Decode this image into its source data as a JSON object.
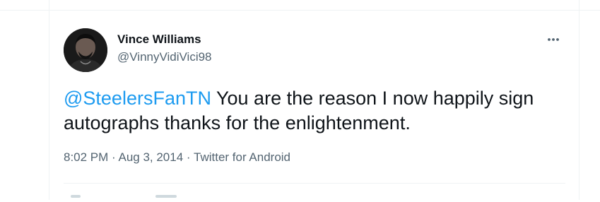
{
  "tweet": {
    "author": {
      "display_name": "Vince Williams",
      "handle": "@VinnyVidiVici98"
    },
    "text": {
      "mention": "@SteelersFanTN",
      "body": " You are the reason I now happily sign autographs thanks for the enlightenment."
    },
    "meta": {
      "time": "8:02 PM",
      "separator": " · ",
      "date": "Aug 3, 2014",
      "source": "Twitter for Android"
    },
    "icons": {
      "more": "more-horizontal-icon",
      "avatar": "profile-photo"
    },
    "colors": {
      "link": "#1d9bf0",
      "secondary_text": "#536471",
      "primary_text": "#0f1419",
      "border": "#eff3f4"
    }
  }
}
